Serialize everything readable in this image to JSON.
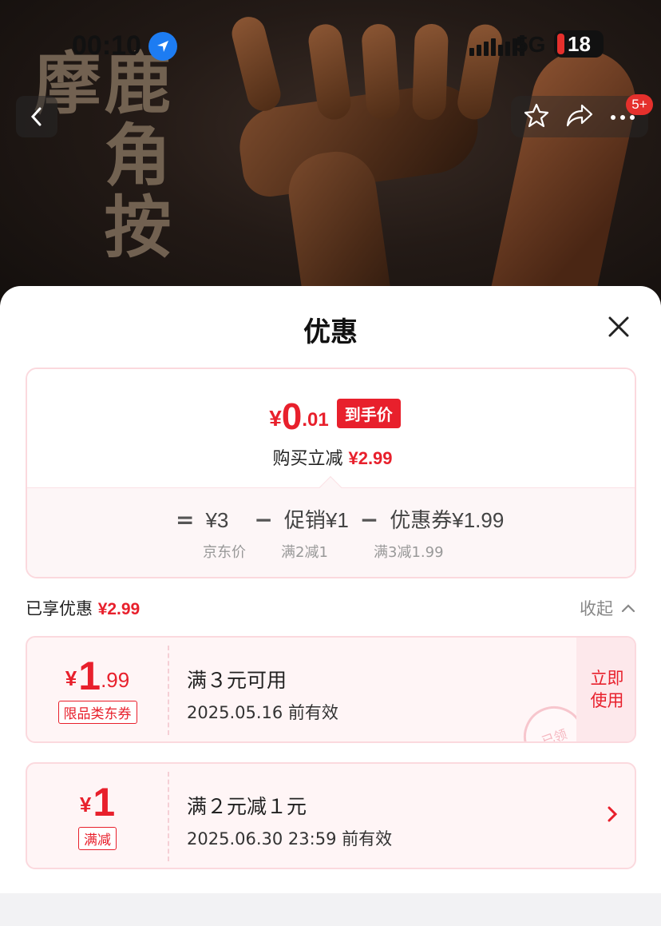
{
  "status_bar": {
    "time": "00:10",
    "network": "5G",
    "battery": "18"
  },
  "hero": {
    "calligraphy": "鹿角按摩"
  },
  "nav": {
    "badge": "5+"
  },
  "sheet": {
    "title": "优惠",
    "summary": {
      "price_symbol": "¥",
      "price_int": "0",
      "price_dec": ".01",
      "price_tag": "到手价",
      "saved_label": "购买立减",
      "saved_value": "¥2.99",
      "eq_sign": "=",
      "base_price": "¥3",
      "base_label": "京东价",
      "minus": "−",
      "promo": "促销¥1",
      "promo_label": "满2减1",
      "coupon": "优惠券¥1.99",
      "coupon_label": "满3减1.99"
    },
    "enjoyed": {
      "label": "已享优惠",
      "value": "¥2.99",
      "collapse": "收起"
    },
    "coupons": [
      {
        "symbol": "¥",
        "int": "1",
        "dec": ".99",
        "tag": "限品类东券",
        "title": "满３元可用",
        "date": "2025.05.16 前有效",
        "action": "立即使用",
        "stamp": "已领"
      },
      {
        "symbol": "¥",
        "int": "1",
        "dec": "",
        "tag": "满减",
        "title": "满２元减１元",
        "date": "2025.06.30 23:59 前有效"
      }
    ]
  }
}
